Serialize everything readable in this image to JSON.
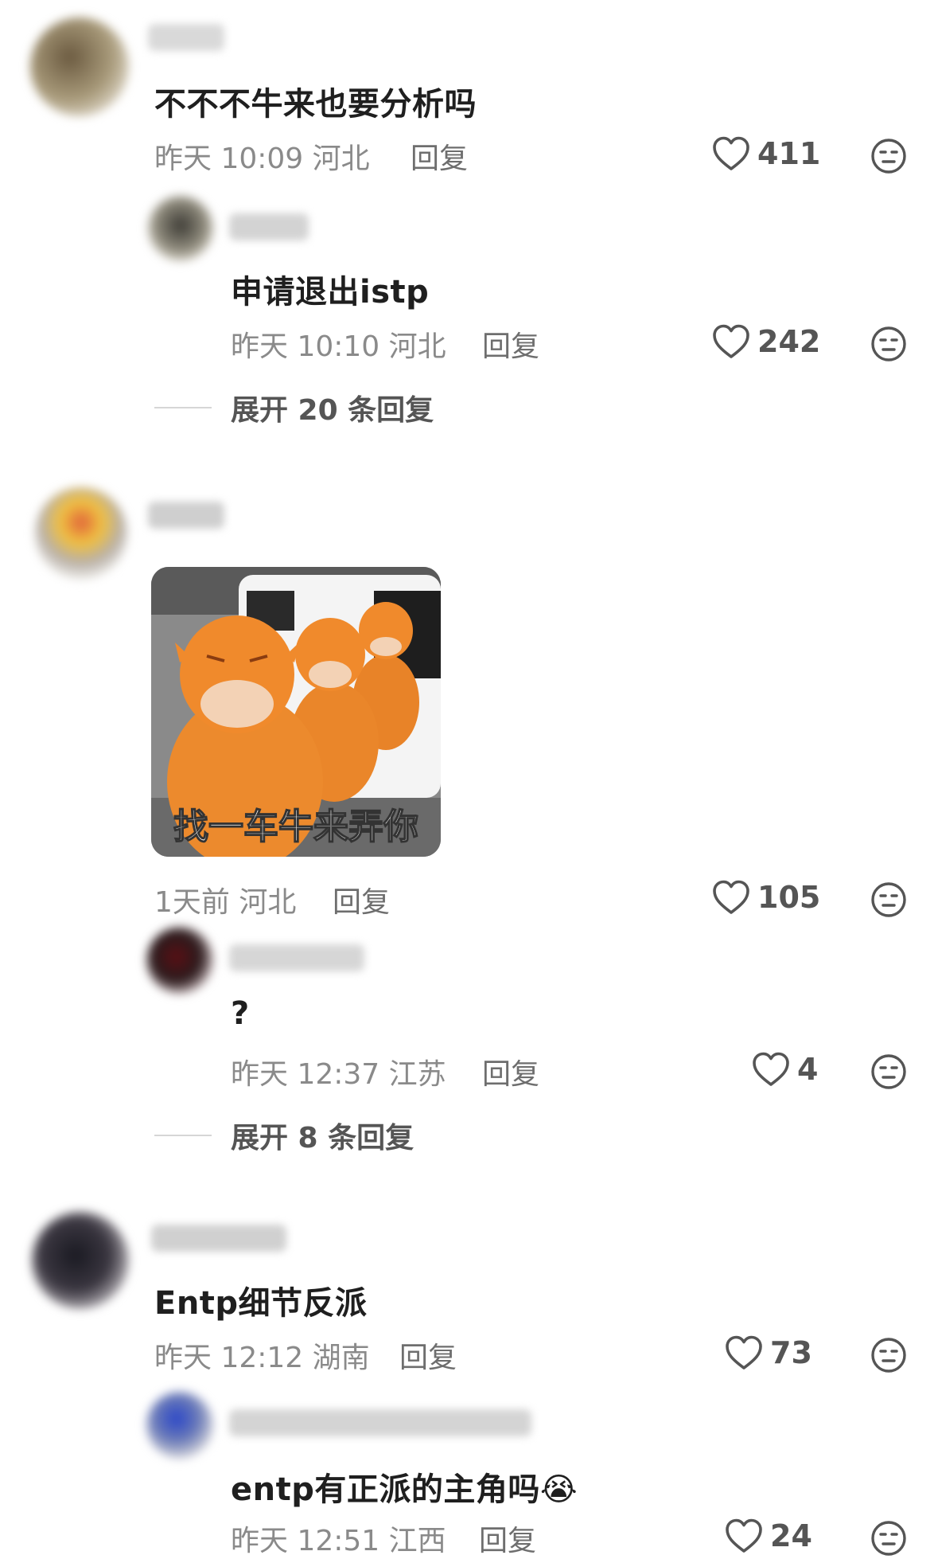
{
  "comments": [
    {
      "text": "不不不牛来也要分析吗",
      "time": "昨天 10:09",
      "location": "河北",
      "reply_label": "回复",
      "likes": "411",
      "replies": [
        {
          "text": "申请退出istp",
          "time": "昨天 10:10",
          "location": "河北",
          "reply_label": "回复",
          "likes": "242"
        }
      ],
      "expand_label": "展开 20 条回复"
    },
    {
      "sticker_caption": "找一车牛来弄你",
      "time": "1天前",
      "location": "河北",
      "reply_label": "回复",
      "likes": "105",
      "replies": [
        {
          "text": "?",
          "time": "昨天 12:37",
          "location": "江苏",
          "reply_label": "回复",
          "likes": "4"
        }
      ],
      "expand_label": "展开 8 条回复"
    },
    {
      "text": "Entp细节反派",
      "time": "昨天 12:12",
      "location": "湖南",
      "reply_label": "回复",
      "likes": "73",
      "replies": [
        {
          "text": "entp有正派的主角吗",
          "emoji": "😭",
          "time": "昨天 12:51",
          "location": "江西",
          "reply_label": "回复",
          "likes": "24"
        }
      ]
    }
  ],
  "icons": {
    "like": "heart-outline-icon",
    "dislike": "meh-face-icon"
  },
  "colors": {
    "text": "#1f1f1f",
    "meta": "#8a8a8a",
    "icon": "#555555",
    "sticker_mascot": "#f08a2c"
  }
}
